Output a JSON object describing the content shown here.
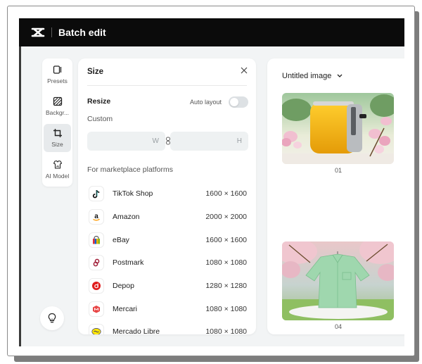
{
  "app": {
    "title": "Batch edit",
    "logo_icon": "capcut-logo-icon"
  },
  "rail": {
    "items": [
      {
        "label": "Presets",
        "icon": "presets-icon",
        "active": false
      },
      {
        "label": "Backgr...",
        "icon": "background-icon",
        "active": false
      },
      {
        "label": "Size",
        "icon": "crop-icon",
        "active": true
      },
      {
        "label": "AI Model",
        "icon": "ai-model-icon",
        "active": false
      }
    ],
    "help_icon": "lightbulb-icon"
  },
  "size_panel": {
    "title": "Size",
    "resize_label": "Resize",
    "auto_layout_label": "Auto layout",
    "auto_layout_on": false,
    "custom_label": "Custom",
    "width_placeholder": "W",
    "height_placeholder": "H",
    "platforms_label": "For marketplace platforms",
    "platforms": [
      {
        "name": "TikTok Shop",
        "size": "1600 × 1600",
        "icon": "tiktok-icon"
      },
      {
        "name": "Amazon",
        "size": "2000 × 2000",
        "icon": "amazon-icon"
      },
      {
        "name": "eBay",
        "size": "1600 × 1600",
        "icon": "ebay-icon"
      },
      {
        "name": "Postmark",
        "size": "1080 × 1080",
        "icon": "postmark-icon"
      },
      {
        "name": "Depop",
        "size": "1280 × 1280",
        "icon": "depop-icon"
      },
      {
        "name": "Mercari",
        "size": "1080 × 1080",
        "icon": "mercari-icon"
      },
      {
        "name": "Mercado Libre",
        "size": "1080 × 1080",
        "icon": "mercado-libre-icon"
      }
    ]
  },
  "workspace": {
    "title": "Untitled image",
    "images": [
      {
        "label": "01",
        "subject": "yellow toaster with pink blossoms"
      },
      {
        "label": "04",
        "subject": "green shirt under cherry blossom tree"
      }
    ]
  },
  "colors": {
    "topbar": "#0b0b0b",
    "panel_bg": "#ffffff",
    "app_bg": "#f2f4f5",
    "active_rail": "#e7eaec"
  }
}
